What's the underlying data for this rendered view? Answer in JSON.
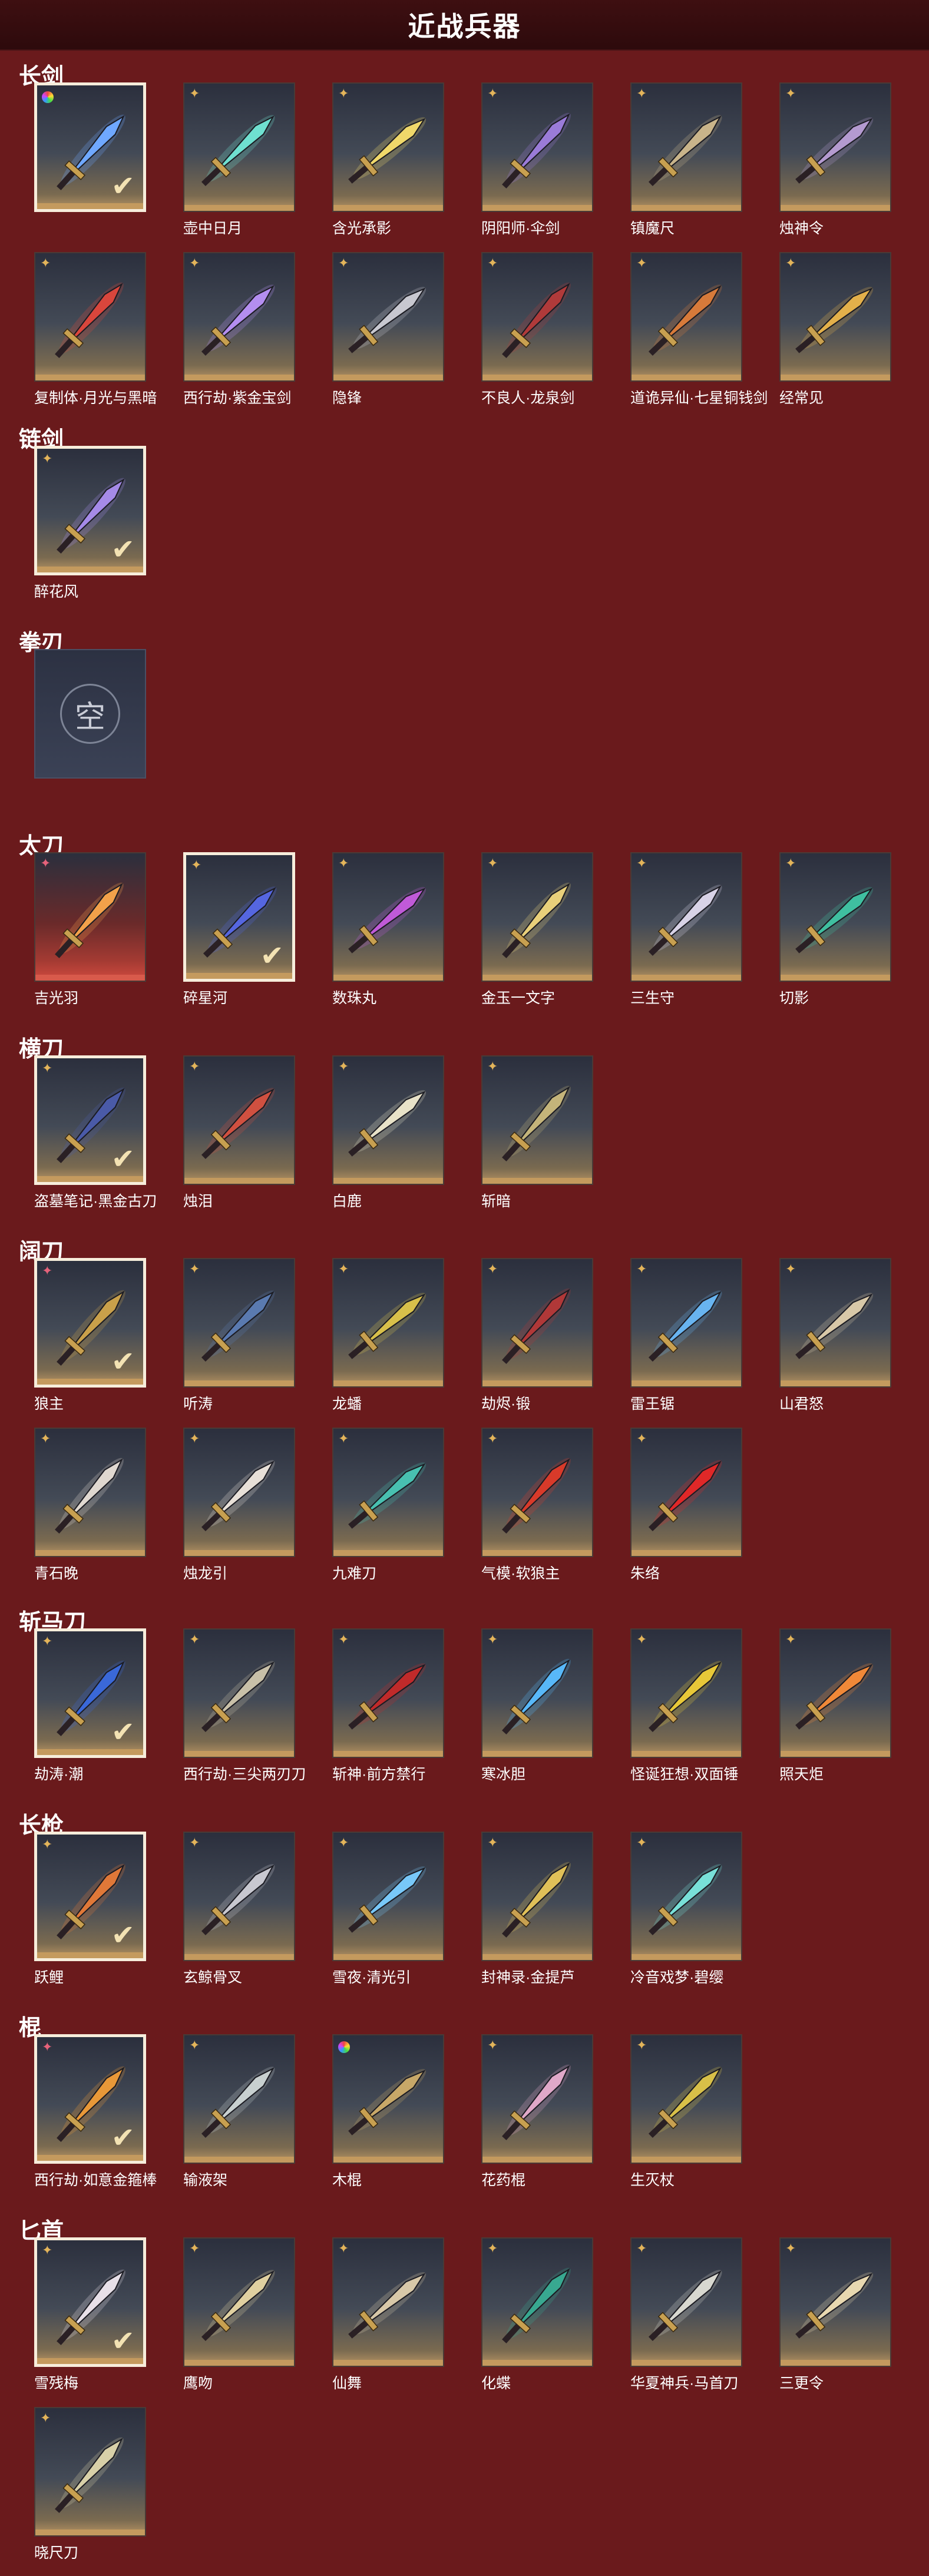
{
  "header": {
    "title": "近战兵器"
  },
  "colors": {
    "background": "#6a1a1c",
    "header": "#2d0a0c",
    "gold_strip": "#c49a5e",
    "red_strip": "#d85a4b"
  },
  "categories": [
    {
      "id": "longsword",
      "title": "长剑",
      "items": [
        {
          "label": "",
          "badge": "ring",
          "selected": true,
          "rarity": "gold",
          "blade": "#6fa8ff"
        },
        {
          "label": "壶中日月",
          "badge": "star",
          "selected": false,
          "rarity": "gold",
          "blade": "#6fe0d0"
        },
        {
          "label": "含光承影",
          "badge": "star",
          "selected": false,
          "rarity": "gold",
          "blade": "#f0d86a"
        },
        {
          "label": "阴阳师·伞剑",
          "badge": "star",
          "selected": false,
          "rarity": "gold",
          "blade": "#9a7bd8"
        },
        {
          "label": "镇魔尺",
          "badge": "star",
          "selected": false,
          "rarity": "gold",
          "blade": "#c9b48a"
        },
        {
          "label": "烛神令",
          "badge": "star",
          "selected": false,
          "rarity": "gold",
          "blade": "#b49ad0"
        },
        {
          "label": "复制体·月光与黑暗",
          "badge": "star",
          "selected": false,
          "rarity": "gold",
          "blade": "#d9463c"
        },
        {
          "label": "西行劫·紫金宝剑",
          "badge": "star",
          "selected": false,
          "rarity": "gold",
          "blade": "#b48ef0"
        },
        {
          "label": "隐锋",
          "badge": "star",
          "selected": false,
          "rarity": "gold",
          "blade": "#c8c8d0"
        },
        {
          "label": "不良人·龙泉剑",
          "badge": "star",
          "selected": false,
          "rarity": "gold",
          "blade": "#b03a3a"
        },
        {
          "label": "道诡异仙·七星铜钱剑",
          "badge": "star",
          "selected": false,
          "rarity": "gold",
          "blade": "#d77a3a"
        },
        {
          "label": "经常见",
          "badge": "star",
          "selected": false,
          "rarity": "gold",
          "blade": "#e3b04a"
        }
      ]
    },
    {
      "id": "chainsword",
      "title": "链剑",
      "items": [
        {
          "label": "醉花风",
          "badge": "star",
          "selected": true,
          "rarity": "gold",
          "blade": "#a58ae8"
        }
      ]
    },
    {
      "id": "fistblade",
      "title": "拳刃",
      "items": [],
      "empty_label": "空"
    },
    {
      "id": "taidao",
      "title": "太刀",
      "items": [
        {
          "label": "吉光羽",
          "badge": "pinkstar",
          "selected": false,
          "rarity": "red",
          "blade": "#f2a14a"
        },
        {
          "label": "碎星河",
          "badge": "star",
          "selected": true,
          "rarity": "gold",
          "blade": "#5566e0"
        },
        {
          "label": "数珠丸",
          "badge": "star",
          "selected": false,
          "rarity": "gold",
          "blade": "#c05ad8"
        },
        {
          "label": "金玉一文字",
          "badge": "star",
          "selected": false,
          "rarity": "gold",
          "blade": "#e9d07a"
        },
        {
          "label": "三生守",
          "badge": "star",
          "selected": false,
          "rarity": "gold",
          "blade": "#d8d2e6"
        },
        {
          "label": "切影",
          "badge": "star",
          "selected": false,
          "rarity": "gold",
          "blade": "#3fbfa0"
        }
      ]
    },
    {
      "id": "hengdao",
      "title": "横刀",
      "items": [
        {
          "label": "盗墓笔记·黑金古刀",
          "badge": "star",
          "selected": true,
          "rarity": "gold",
          "blade": "#4a5aa8"
        },
        {
          "label": "烛泪",
          "badge": "star",
          "selected": false,
          "rarity": "gold",
          "blade": "#d05040"
        },
        {
          "label": "白鹿",
          "badge": "star",
          "selected": false,
          "rarity": "gold",
          "blade": "#e8e2c8"
        },
        {
          "label": "斩暗",
          "badge": "star",
          "selected": false,
          "rarity": "gold",
          "blade": "#c4b47a"
        }
      ]
    },
    {
      "id": "kuodao",
      "title": "阔刀",
      "items": [
        {
          "label": "狼主",
          "badge": "pinkstar",
          "selected": true,
          "rarity": "gold",
          "blade": "#c9a04a"
        },
        {
          "label": "听涛",
          "badge": "star",
          "selected": false,
          "rarity": "gold",
          "blade": "#5a7ab0"
        },
        {
          "label": "龙蟠",
          "badge": "star",
          "selected": false,
          "rarity": "gold",
          "blade": "#d8c04a"
        },
        {
          "label": "劫烬·锻",
          "badge": "star",
          "selected": false,
          "rarity": "gold",
          "blade": "#b03838"
        },
        {
          "label": "雷王锯",
          "badge": "star",
          "selected": false,
          "rarity": "gold",
          "blade": "#68b4f0"
        },
        {
          "label": "山君怒",
          "badge": "star",
          "selected": false,
          "rarity": "gold",
          "blade": "#d8c8a8"
        },
        {
          "label": "青石晚",
          "badge": "star",
          "selected": false,
          "rarity": "gold",
          "blade": "#e0d8d0"
        },
        {
          "label": "烛龙引",
          "badge": "star",
          "selected": false,
          "rarity": "gold",
          "blade": "#e8e0d8"
        },
        {
          "label": "九难刀",
          "badge": "star",
          "selected": false,
          "rarity": "gold",
          "blade": "#48c0b0"
        },
        {
          "label": "气模·软狼主",
          "badge": "star",
          "selected": false,
          "rarity": "gold",
          "blade": "#d83a2a"
        },
        {
          "label": "朱络",
          "badge": "star",
          "selected": false,
          "rarity": "gold",
          "blade": "#e02828"
        }
      ]
    },
    {
      "id": "zhanmadao",
      "title": "斩马刀",
      "items": [
        {
          "label": "劫涛·潮",
          "badge": "star",
          "selected": true,
          "rarity": "gold",
          "blade": "#3a68d8"
        },
        {
          "label": "西行劫·三尖两刃刀",
          "badge": "star",
          "selected": false,
          "rarity": "gold",
          "blade": "#c8c0a8"
        },
        {
          "label": "斩神·前方禁行",
          "badge": "star",
          "selected": false,
          "rarity": "gold",
          "blade": "#c02a2a"
        },
        {
          "label": "寒冰胆",
          "badge": "star",
          "selected": false,
          "rarity": "gold",
          "blade": "#58b8f8"
        },
        {
          "label": "怪诞狂想·双面锤",
          "badge": "star",
          "selected": false,
          "rarity": "gold",
          "blade": "#e8c838"
        },
        {
          "label": "照天炬",
          "badge": "star",
          "selected": false,
          "rarity": "gold",
          "blade": "#f08838"
        }
      ]
    },
    {
      "id": "spear",
      "title": "长枪",
      "items": [
        {
          "label": "跃鲤",
          "badge": "star",
          "selected": true,
          "rarity": "gold",
          "blade": "#e07838"
        },
        {
          "label": "玄鲸骨叉",
          "badge": "star",
          "selected": false,
          "rarity": "gold",
          "blade": "#c8c8d0"
        },
        {
          "label": "雪夜·清光引",
          "badge": "star",
          "selected": false,
          "rarity": "gold",
          "blade": "#78c8f8"
        },
        {
          "label": "封神录·金提芦",
          "badge": "star",
          "selected": false,
          "rarity": "gold",
          "blade": "#e0c058"
        },
        {
          "label": "冷音戏梦·碧缨",
          "badge": "star",
          "selected": false,
          "rarity": "gold",
          "blade": "#78e0d8"
        }
      ]
    },
    {
      "id": "staff",
      "title": "棍",
      "items": [
        {
          "label": "西行劫·如意金箍棒",
          "badge": "pinkstar",
          "selected": true,
          "rarity": "gold",
          "blade": "#e89838"
        },
        {
          "label": "输液架",
          "badge": "star",
          "selected": false,
          "rarity": "gold",
          "blade": "#c8d0d0"
        },
        {
          "label": "木棍",
          "badge": "ring",
          "selected": false,
          "rarity": "gold",
          "blade": "#c8a868"
        },
        {
          "label": "花药棍",
          "badge": "star",
          "selected": false,
          "rarity": "gold",
          "blade": "#e0a8c8"
        },
        {
          "label": "生灭杖",
          "badge": "star",
          "selected": false,
          "rarity": "gold",
          "blade": "#d8c048"
        }
      ]
    },
    {
      "id": "dagger",
      "title": "匕首",
      "items": [
        {
          "label": "雪残梅",
          "badge": "star",
          "selected": true,
          "rarity": "gold",
          "blade": "#e8e0e8"
        },
        {
          "label": "鹰吻",
          "badge": "star",
          "selected": false,
          "rarity": "gold",
          "blade": "#e0d0a0"
        },
        {
          "label": "仙舞",
          "badge": "star",
          "selected": false,
          "rarity": "gold",
          "blade": "#d8c8a8"
        },
        {
          "label": "化蝶",
          "badge": "star",
          "selected": false,
          "rarity": "gold",
          "blade": "#38a890"
        },
        {
          "label": "华夏神兵·马首刀",
          "badge": "star",
          "selected": false,
          "rarity": "gold",
          "blade": "#d8d8d0"
        },
        {
          "label": "三更令",
          "badge": "star",
          "selected": false,
          "rarity": "gold",
          "blade": "#e8d8b0"
        },
        {
          "label": "晓尺刀",
          "badge": "star",
          "selected": false,
          "rarity": "gold",
          "blade": "#d8d0a8"
        }
      ]
    }
  ]
}
